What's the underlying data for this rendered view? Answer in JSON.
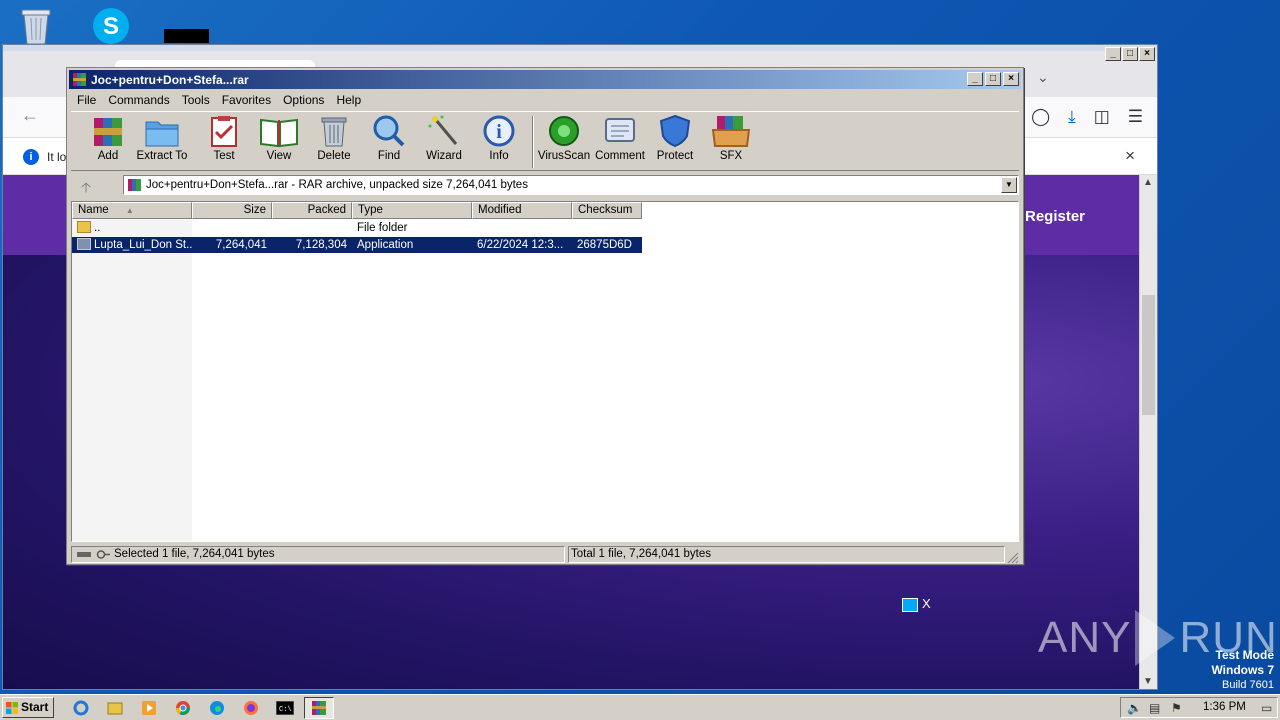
{
  "winrar": {
    "title": "Joc+pentru+Don+Stefa...rar",
    "menu": [
      "File",
      "Commands",
      "Tools",
      "Favorites",
      "Options",
      "Help"
    ],
    "toolbar": [
      {
        "label": "Add",
        "icon": "add-icon"
      },
      {
        "label": "Extract To",
        "icon": "extract-folder-icon"
      },
      {
        "label": "Test",
        "icon": "test-clipboard-icon"
      },
      {
        "label": "View",
        "icon": "view-book-icon"
      },
      {
        "label": "Delete",
        "icon": "trash-icon"
      },
      {
        "label": "Find",
        "icon": "magnifier-icon"
      },
      {
        "label": "Wizard",
        "icon": "wand-icon"
      },
      {
        "label": "Info",
        "icon": "info-icon"
      },
      {
        "label": "VirusScan",
        "icon": "virus-icon"
      },
      {
        "label": "Comment",
        "icon": "comment-icon"
      },
      {
        "label": "Protect",
        "icon": "shield-icon"
      },
      {
        "label": "SFX",
        "icon": "sfx-box-icon"
      }
    ],
    "address": "Joc+pentru+Don+Stefa...rar - RAR archive, unpacked size 7,264,041 bytes",
    "columns": [
      "Name",
      "Size",
      "Packed",
      "Type",
      "Modified",
      "Checksum"
    ],
    "rows": [
      {
        "name": "..",
        "size": "",
        "packed": "",
        "type": "File folder",
        "modified": "",
        "checksum": ""
      },
      {
        "name": "Lupta_Lui_Don St...",
        "size": "7,264,041",
        "packed": "7,128,304",
        "type": "Application",
        "modified": "6/22/2024 12:3...",
        "checksum": "26875D6D"
      }
    ],
    "status_left": "Selected 1 file, 7,264,041 bytes",
    "status_right": "Total 1 file, 7,264,041 bytes"
  },
  "firefox": {
    "notification_text": "It lo",
    "register_label": "Register"
  },
  "watermark": {
    "brand_left": "ANY",
    "brand_right": "RUN",
    "test_mode": "Test Mode",
    "os": "Windows 7",
    "build": "Build 7601"
  },
  "taskbar": {
    "start_label": "Start",
    "clock": "1:36 PM"
  },
  "colors": {
    "title_bar_start": "#0a246a",
    "title_bar_end": "#a6caf0",
    "selection": "#0a246a",
    "site_header": "#5e2ca5"
  }
}
